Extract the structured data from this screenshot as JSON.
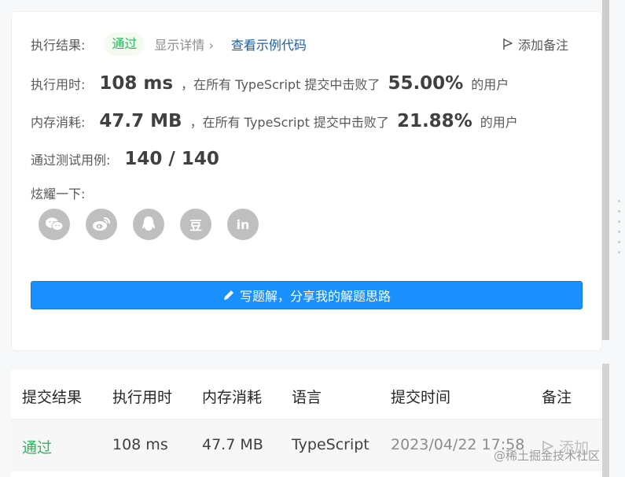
{
  "result": {
    "label": "执行结果:",
    "status": "通过",
    "detail_link": "显示详情 ›",
    "example_link": "查看示例代码",
    "add_note": "添加备注"
  },
  "runtime": {
    "label": "执行用时:",
    "value": "108 ms",
    "middle": "，在所有 TypeScript 提交中击败了",
    "percent": "55.00%",
    "tail": "的用户"
  },
  "memory": {
    "label": "内存消耗:",
    "value": "47.7 MB",
    "middle": "，在所有 TypeScript 提交中击败了",
    "percent": "21.88%",
    "tail": "的用户"
  },
  "tests": {
    "label": "通过测试用例:",
    "value": "140 / 140"
  },
  "share": {
    "label": "炫耀一下:",
    "icons": [
      "wechat-icon",
      "weibo-icon",
      "qq-icon",
      "douban-icon",
      "linkedin-icon"
    ],
    "douban_glyph": "豆",
    "linkedin_glyph": "in"
  },
  "write_solution": "写题解，分享我的解题思路",
  "table": {
    "headers": [
      "提交结果",
      "执行用时",
      "内存消耗",
      "语言",
      "提交时间",
      "备注"
    ],
    "row": {
      "result": "通过",
      "runtime": "108 ms",
      "memory": "47.7 MB",
      "language": "TypeScript",
      "time": "2023/04/22 17:58",
      "note": "添加"
    }
  },
  "watermark": "@稀土掘金技术社区",
  "colors": {
    "pass": "#2db55d",
    "link": "#1a5fa6",
    "button": "#1a90ff"
  }
}
